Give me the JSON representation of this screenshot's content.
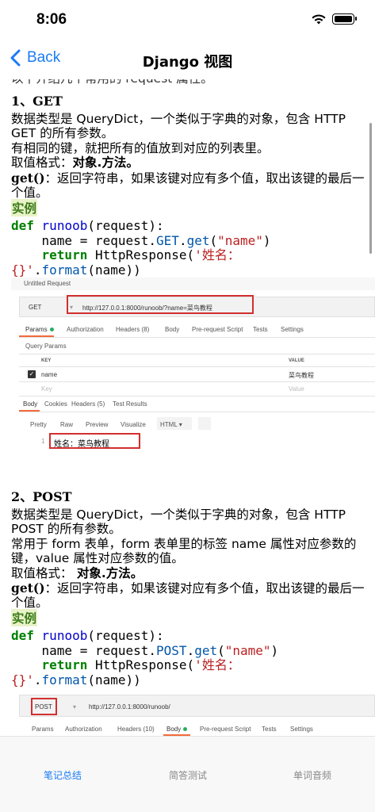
{
  "status": {
    "time": "8:06"
  },
  "nav": {
    "back_label": "Back",
    "title": "Django 视图"
  },
  "article": {
    "cut_line": "以下介绍几个常用的 request 属性。",
    "get": {
      "heading": "1、GET",
      "line1": "数据类型是 QueryDict，一个类似于字典的对象，包含 HTTP",
      "line2": "GET 的所有参数。",
      "line3": "有相同的键，就把所有的值放到对应的列表里。",
      "format_label": "取值格式：",
      "format_value": "对象.方法。",
      "method_name": "get()",
      "method_desc1": "：返回字符串，如果该键对应有多个值，取出该键的最后一",
      "method_desc2": "个值。",
      "example_label": "实例",
      "code": {
        "def": "def",
        "func": "runoob",
        "arg": "(request):",
        "assign": "    name = request.",
        "attr": "GET",
        "dot": ".",
        "get": "get",
        "open": "(",
        "key": "\"name\"",
        "close": ")",
        "ret_indent": "    ",
        "ret": "return",
        "ret_call": " HttpResponse(",
        "str": "'姓名：",
        "str2": "{}'",
        "fmt_dot": ".",
        "fmt": "format",
        "fmt_args": "(name))"
      },
      "screenshot": {
        "title": "Untitled Request",
        "method": "GET",
        "url": "http://127.0.0.1:8000/runoob/?name=菜鸟教程",
        "tabs": [
          "Params",
          "Authorization",
          "Headers (8)",
          "Body",
          "Pre-request Script",
          "Tests",
          "Settings"
        ],
        "query_params": "Query Params",
        "col_key": "KEY",
        "col_value": "VALUE",
        "row_key": "name",
        "row_value": "菜鸟教程",
        "ph_key": "Key",
        "ph_value": "Value",
        "resp_tabs": [
          "Body",
          "Cookies",
          "Headers (5)",
          "Test Results"
        ],
        "view_tabs": [
          "Pretty",
          "Raw",
          "Preview",
          "Visualize"
        ],
        "format": "HTML",
        "line_no": "1",
        "response": "姓名：菜鸟教程"
      }
    },
    "post": {
      "heading": "2、POST",
      "line1": "数据类型是 QueryDict，一个类似于字典的对象，包含 HTTP",
      "line2": "POST 的所有参数。",
      "line3": "常用于 form 表单，form 表单里的标签 name 属性对应参数的",
      "line4": "键，value 属性对应参数的值。",
      "format_label": "取值格式：",
      "format_value": " 对象.方法。",
      "method_name": "get()",
      "method_desc1": "：返回字符串，如果该键对应有多个值，取出该键的最后一",
      "method_desc2": "个值。",
      "example_label": "实例",
      "code": {
        "def": "def",
        "func": "runoob",
        "arg": "(request):",
        "assign": "    name = request.",
        "attr": "POST",
        "dot": ".",
        "get": "get",
        "open": "(",
        "key": "\"name\"",
        "close": ")",
        "ret_indent": "    ",
        "ret": "return",
        "ret_call": " HttpResponse(",
        "str": "'姓名：",
        "str2": "{}'",
        "fmt_dot": ".",
        "fmt": "format",
        "fmt_args": "(name))"
      },
      "screenshot": {
        "method": "POST",
        "url": "http://127.0.0.1:8000/runoob/",
        "tabs": [
          "Params",
          "Authorization",
          "Headers (10)",
          "Body",
          "Pre-request Script",
          "Tests",
          "Settings"
        ]
      }
    }
  },
  "tabbar": {
    "items": [
      {
        "label": "笔记总结",
        "active": true
      },
      {
        "label": "简答测试",
        "active": false
      },
      {
        "label": "单词音频",
        "active": false
      }
    ]
  },
  "colors": {
    "accent": "#1a7cf5",
    "keyword": "#008000",
    "string": "#ba2121",
    "example_bg": "#e8f3c8",
    "highlight": "#d32f2f"
  }
}
